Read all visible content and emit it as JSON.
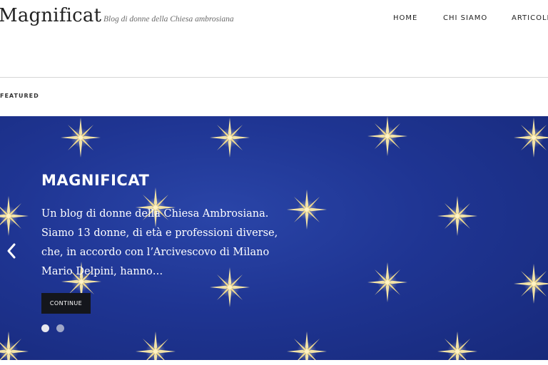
{
  "site": {
    "title": "Magnificat",
    "tagline": "Blog di donne della Chiesa ambrosiana"
  },
  "nav": {
    "items": [
      {
        "label": "HOME"
      },
      {
        "label": "CHI SIAMO"
      },
      {
        "label": "ARTICOLI"
      }
    ]
  },
  "featured": {
    "label": "FEATURED"
  },
  "slider": {
    "title": "MAGNIFICAT",
    "excerpt_lines": [
      "Un blog di donne della Chiesa Ambrosiana.",
      "Siamo 13 donne, di età e professioni diverse,",
      "che, in accordo con l’Arcivescovo di Milano",
      "Mario Delpini, hanno…"
    ],
    "button_label": "CONTINUE",
    "slide_count": 2,
    "active_slide": 1,
    "background_color": "#1f3593",
    "star_color": "#f3e3a6"
  },
  "icons": {
    "prev": "chevron-left-icon",
    "star": "star-icon"
  }
}
